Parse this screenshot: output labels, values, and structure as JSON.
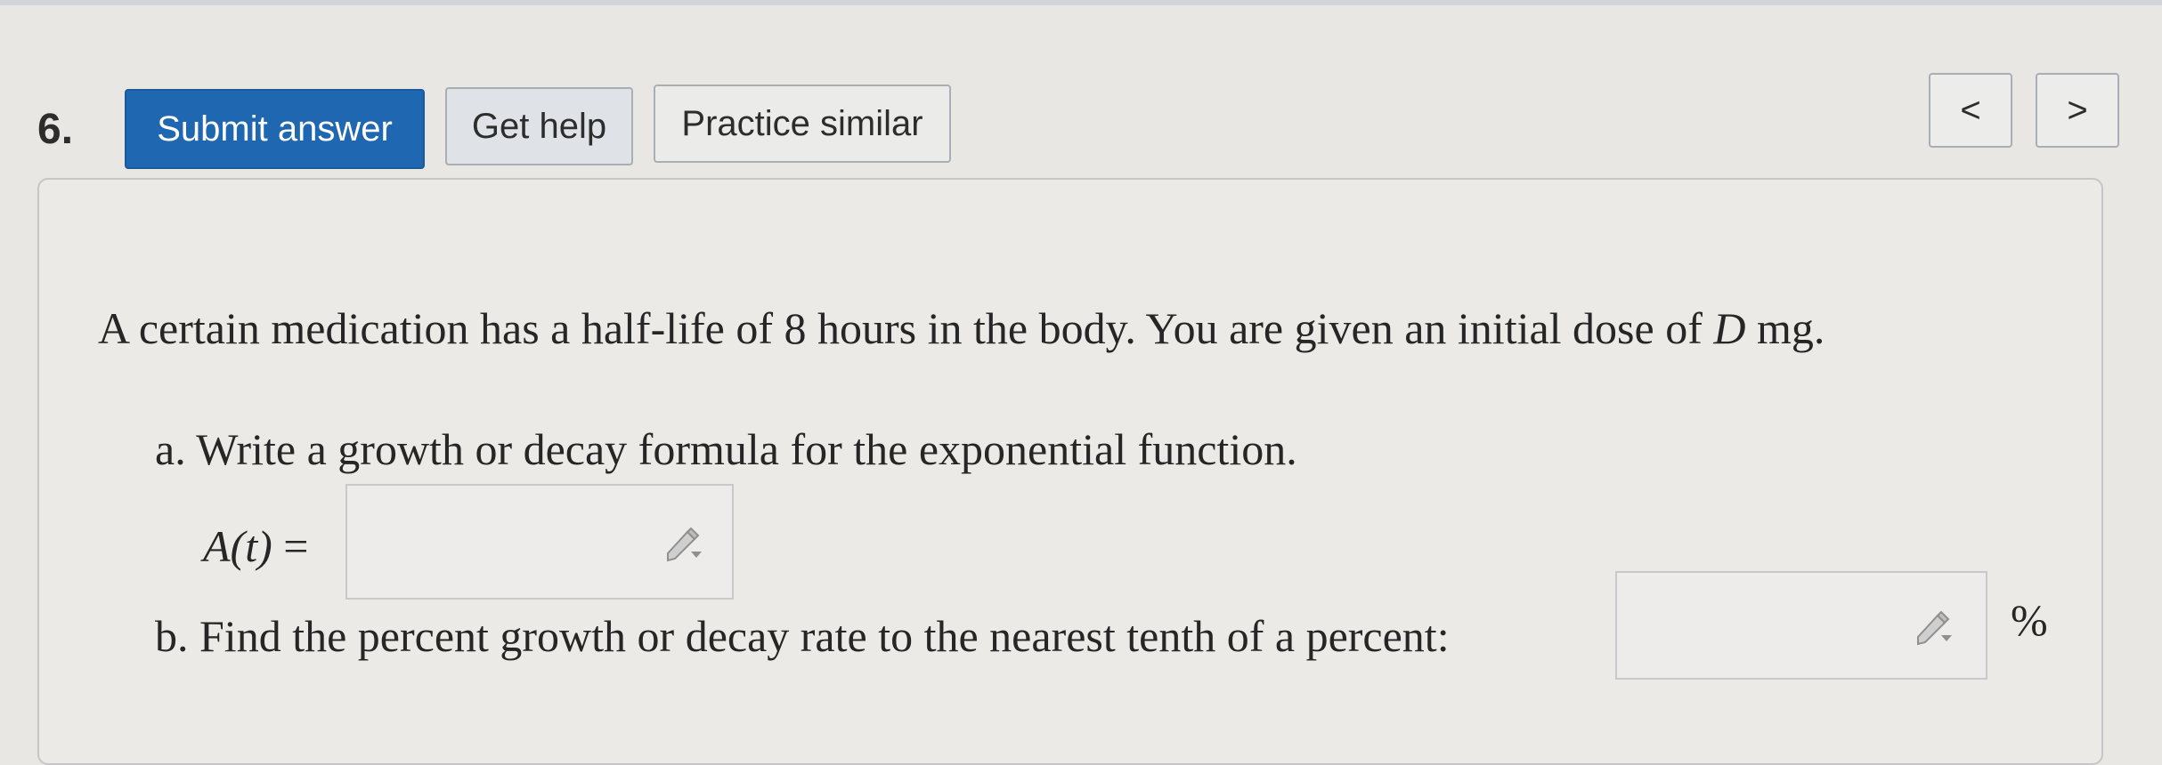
{
  "question": {
    "number": "6.",
    "toolbar": {
      "submit_label": "Submit answer",
      "help_label": "Get help",
      "practice_label": "Practice similar",
      "prev_label": "<",
      "next_label": ">"
    },
    "stem_prefix": "A certain medication has a half-life of 8 hours in the body. You are given an initial dose of ",
    "stem_var": "D",
    "stem_suffix": " mg.",
    "part_a": {
      "text": "a. Write a growth or decay formula for the exponential function.",
      "label": "A(t)",
      "equals": " = ",
      "value": ""
    },
    "part_b": {
      "text": "b. Find the percent growth or decay rate to the nearest tenth of a percent:",
      "value": "",
      "unit": "%"
    },
    "input_icon": "pencil-dropdown-icon"
  }
}
